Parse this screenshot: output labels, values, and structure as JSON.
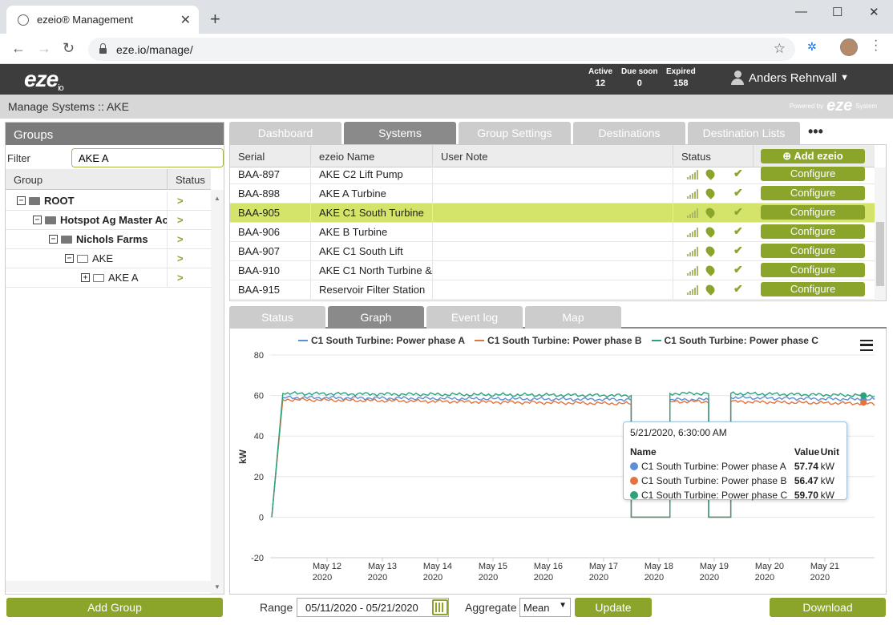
{
  "browser": {
    "tab_title": "ezeio® Management",
    "url": "eze.io/manage/"
  },
  "app": {
    "logo": "eze",
    "logo_sub": "io",
    "stats": [
      {
        "label": "Active",
        "value": "12"
      },
      {
        "label": "Due soon",
        "value": "0"
      },
      {
        "label": "Expired",
        "value": "158"
      }
    ],
    "user": "Anders Rehnvall",
    "breadcrumb": "Manage Systems :: AKE",
    "powered_by": "Powered by",
    "powered_logo": "eze",
    "powered_suffix": "System"
  },
  "groups": {
    "title": "Groups",
    "filter_label": "Filter",
    "filter_value": "AKE A",
    "col_group": "Group",
    "col_status": "Status",
    "tree": [
      {
        "label": "ROOT",
        "bold": true,
        "indent": 0,
        "toggle": "−",
        "folder": "filled"
      },
      {
        "label": "Hotspot Ag Master Account",
        "bold": true,
        "indent": 1,
        "toggle": "−",
        "folder": "filled"
      },
      {
        "label": "Nichols Farms",
        "bold": true,
        "indent": 2,
        "toggle": "−",
        "folder": "filled"
      },
      {
        "label": "AKE",
        "bold": false,
        "indent": 3,
        "toggle": "−",
        "folder": "open"
      },
      {
        "label": "AKE A",
        "bold": false,
        "indent": 4,
        "toggle": "+",
        "folder": "open"
      }
    ],
    "add_button": "Add Group"
  },
  "tabs": [
    "Dashboard",
    "Systems",
    "Group Settings",
    "Destinations",
    "Destination Lists"
  ],
  "more_tabs": "•••",
  "systems": {
    "cols": [
      "Serial",
      "ezeio Name",
      "User Note",
      "Status"
    ],
    "add_button": "Add ezeio",
    "configure_label": "Configure",
    "rows": [
      {
        "serial": "BAA-897",
        "name": "AKE C2 Lift Pump",
        "note": ""
      },
      {
        "serial": "BAA-898",
        "name": "AKE A Turbine",
        "note": ""
      },
      {
        "serial": "BAA-905",
        "name": "AKE C1 South Turbine",
        "note": "",
        "selected": true
      },
      {
        "serial": "BAA-906",
        "name": "AKE B Turbine",
        "note": ""
      },
      {
        "serial": "BAA-907",
        "name": "AKE C1 South Lift",
        "note": ""
      },
      {
        "serial": "BAA-910",
        "name": "AKE C1 North Turbine &",
        "note": ""
      },
      {
        "serial": "BAA-915",
        "name": "Reservoir Filter Station",
        "note": ""
      }
    ]
  },
  "bottom_tabs": [
    "Status",
    "Graph",
    "Event log",
    "Map"
  ],
  "colors": {
    "accent": "#8aa52a",
    "series_a": "#5b8fd6",
    "series_b": "#e3733f",
    "series_c": "#2aa37a"
  },
  "chart_data": {
    "type": "line",
    "ylabel": "kW",
    "ylim": [
      -20,
      80
    ],
    "yticks": [
      "80",
      "60",
      "40",
      "20",
      "0",
      "-20"
    ],
    "xticks": [
      {
        "d": "May 12",
        "y": "2020"
      },
      {
        "d": "May 13",
        "y": "2020"
      },
      {
        "d": "May 14",
        "y": "2020"
      },
      {
        "d": "May 15",
        "y": "2020"
      },
      {
        "d": "May 16",
        "y": "2020"
      },
      {
        "d": "May 17",
        "y": "2020"
      },
      {
        "d": "May 18",
        "y": "2020"
      },
      {
        "d": "May 19",
        "y": "2020"
      },
      {
        "d": "May 20",
        "y": "2020"
      },
      {
        "d": "May 21",
        "y": "2020"
      }
    ],
    "series": [
      {
        "name": "C1 South Turbine: Power phase A",
        "x": [
          "May 11",
          "May 11.2",
          "May 17.5",
          "May 17.5",
          "May 18.2",
          "May 18.2",
          "May 18.9",
          "May 18.9",
          "May 19.3",
          "May 19.3",
          "May 21.9"
        ],
        "values": [
          0,
          59,
          58,
          0,
          0,
          58,
          58,
          0,
          0,
          59,
          58
        ]
      },
      {
        "name": "C1 South Turbine: Power phase B",
        "x": [
          "May 11",
          "May 11.2",
          "May 17.5",
          "May 17.5",
          "May 18.2",
          "May 18.2",
          "May 18.9",
          "May 18.9",
          "May 19.3",
          "May 19.3",
          "May 21.9"
        ],
        "values": [
          0,
          58,
          56,
          0,
          0,
          57,
          57,
          0,
          0,
          57,
          56
        ]
      },
      {
        "name": "C1 South Turbine: Power phase C",
        "x": [
          "May 11",
          "May 11.2",
          "May 17.5",
          "May 17.5",
          "May 18.2",
          "May 18.2",
          "May 18.9",
          "May 18.9",
          "May 19.3",
          "May 19.3",
          "May 21.9"
        ],
        "values": [
          0,
          61,
          60,
          0,
          0,
          61,
          61,
          0,
          0,
          61,
          60
        ]
      }
    ],
    "legend_position": "top",
    "tooltip": {
      "date": "5/21/2020, 6:30:00 AM",
      "headers": [
        "Name",
        "Value",
        "Unit"
      ],
      "rows": [
        {
          "name": "C1 South Turbine: Power phase A",
          "value": "57.74",
          "unit": "kW"
        },
        {
          "name": "C1 South Turbine: Power phase B",
          "value": "56.47",
          "unit": "kW"
        },
        {
          "name": "C1 South Turbine: Power phase C",
          "value": "59.70",
          "unit": "kW"
        }
      ]
    }
  },
  "footer": {
    "range_label": "Range",
    "range_value": "05/11/2020 - 05/21/2020",
    "aggregate_label": "Aggregate",
    "aggregate_value": "Mean",
    "update_button": "Update",
    "download_button": "Download"
  }
}
